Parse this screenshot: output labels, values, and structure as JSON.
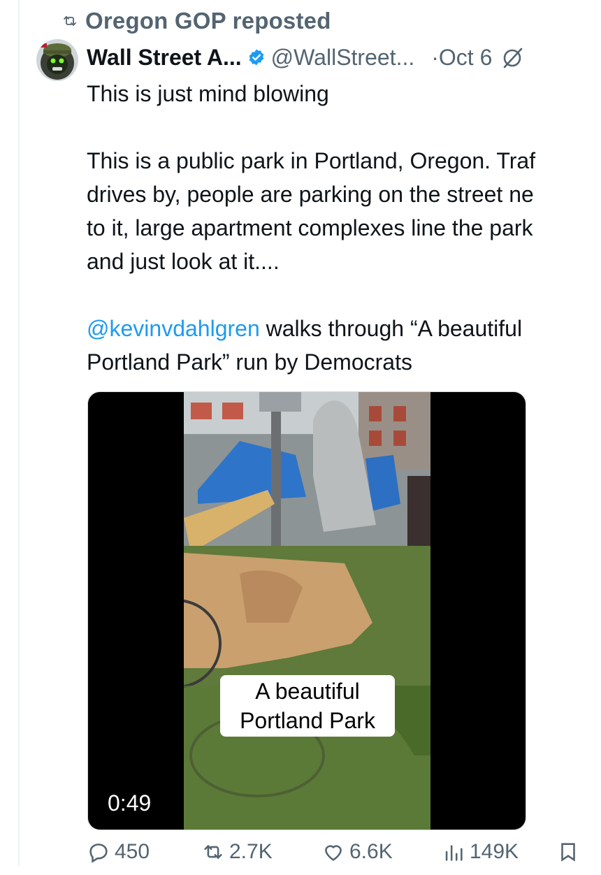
{
  "repost": {
    "label": "Oregon GOP reposted",
    "icon": "repost-icon"
  },
  "author": {
    "name": "Wall Street A...",
    "handle": "@WallStreet...",
    "separator": "·",
    "date": "Oct 6",
    "verified_icon": "verified-badge-icon",
    "avatar_icon": "avatar"
  },
  "tweet": {
    "line1": "This is just mind blowing",
    "line2": "This is a public park in Portland, Oregon. Traf",
    "line3": "drives by, people are parking on the street ne",
    "line4": "to it, large apartment complexes line the park",
    "line5": "and just look at it....",
    "mention": "@kevinvdahlgren",
    "line6_rest": " walks through “A beautiful",
    "line7": "Portland Park” run by Democrats"
  },
  "media": {
    "caption_line1": "A beautiful",
    "caption_line2": "Portland Park",
    "duration": "0:49"
  },
  "actions": {
    "replies": "450",
    "reposts": "2.7K",
    "likes": "6.6K",
    "views": "149K"
  },
  "colors": {
    "text": "#0f1419",
    "secondary": "#536471",
    "link": "#1d9bf0",
    "verified": "#1d9bf0"
  }
}
